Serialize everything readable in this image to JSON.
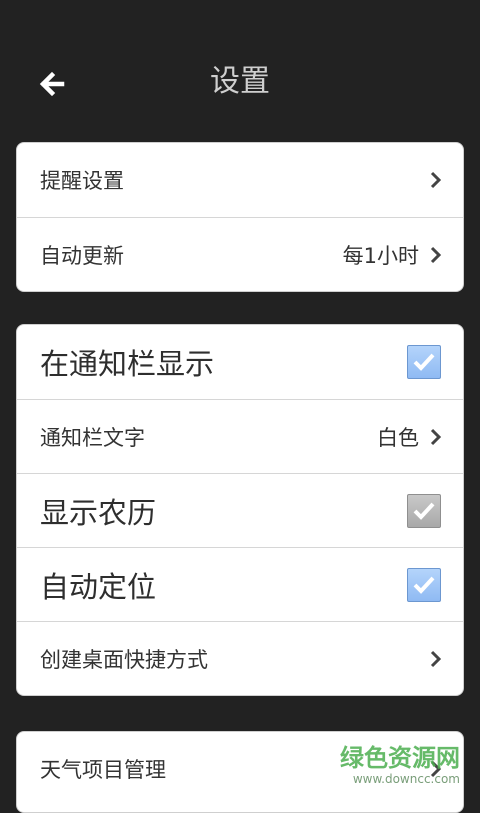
{
  "header": {
    "title": "设置",
    "back_icon": "back-arrow-icon"
  },
  "group1": {
    "reminder": {
      "label": "提醒设置",
      "icon": "chevron-right-icon"
    },
    "auto_update": {
      "label": "自动更新",
      "value": "每1小时",
      "icon": "chevron-right-icon"
    }
  },
  "group2": {
    "show_in_notification": {
      "label": "在通知栏显示",
      "checked": true,
      "checkbox_color": "#9cc4f6"
    },
    "notification_text": {
      "label": "通知栏文字",
      "value": "白色",
      "icon": "chevron-right-icon"
    },
    "show_lunar": {
      "label": "显示农历",
      "checked": true,
      "enabled": false,
      "checkbox_color": "#b8b8b8"
    },
    "auto_locate": {
      "label": "自动定位",
      "checked": true,
      "checkbox_color": "#9cc4f6"
    },
    "create_shortcut": {
      "label": "创建桌面快捷方式",
      "icon": "chevron-right-icon"
    }
  },
  "group3": {
    "weather_items": {
      "label": "天气项目管理",
      "icon": "chevron-right-icon"
    }
  },
  "watermark": {
    "text": "绿色资源网",
    "url": "www.downcc.com"
  },
  "colors": {
    "background": "#222222",
    "card": "#ffffff",
    "text": "#333333",
    "title": "#cfcfcf",
    "watermark_green": "#4caf50"
  }
}
